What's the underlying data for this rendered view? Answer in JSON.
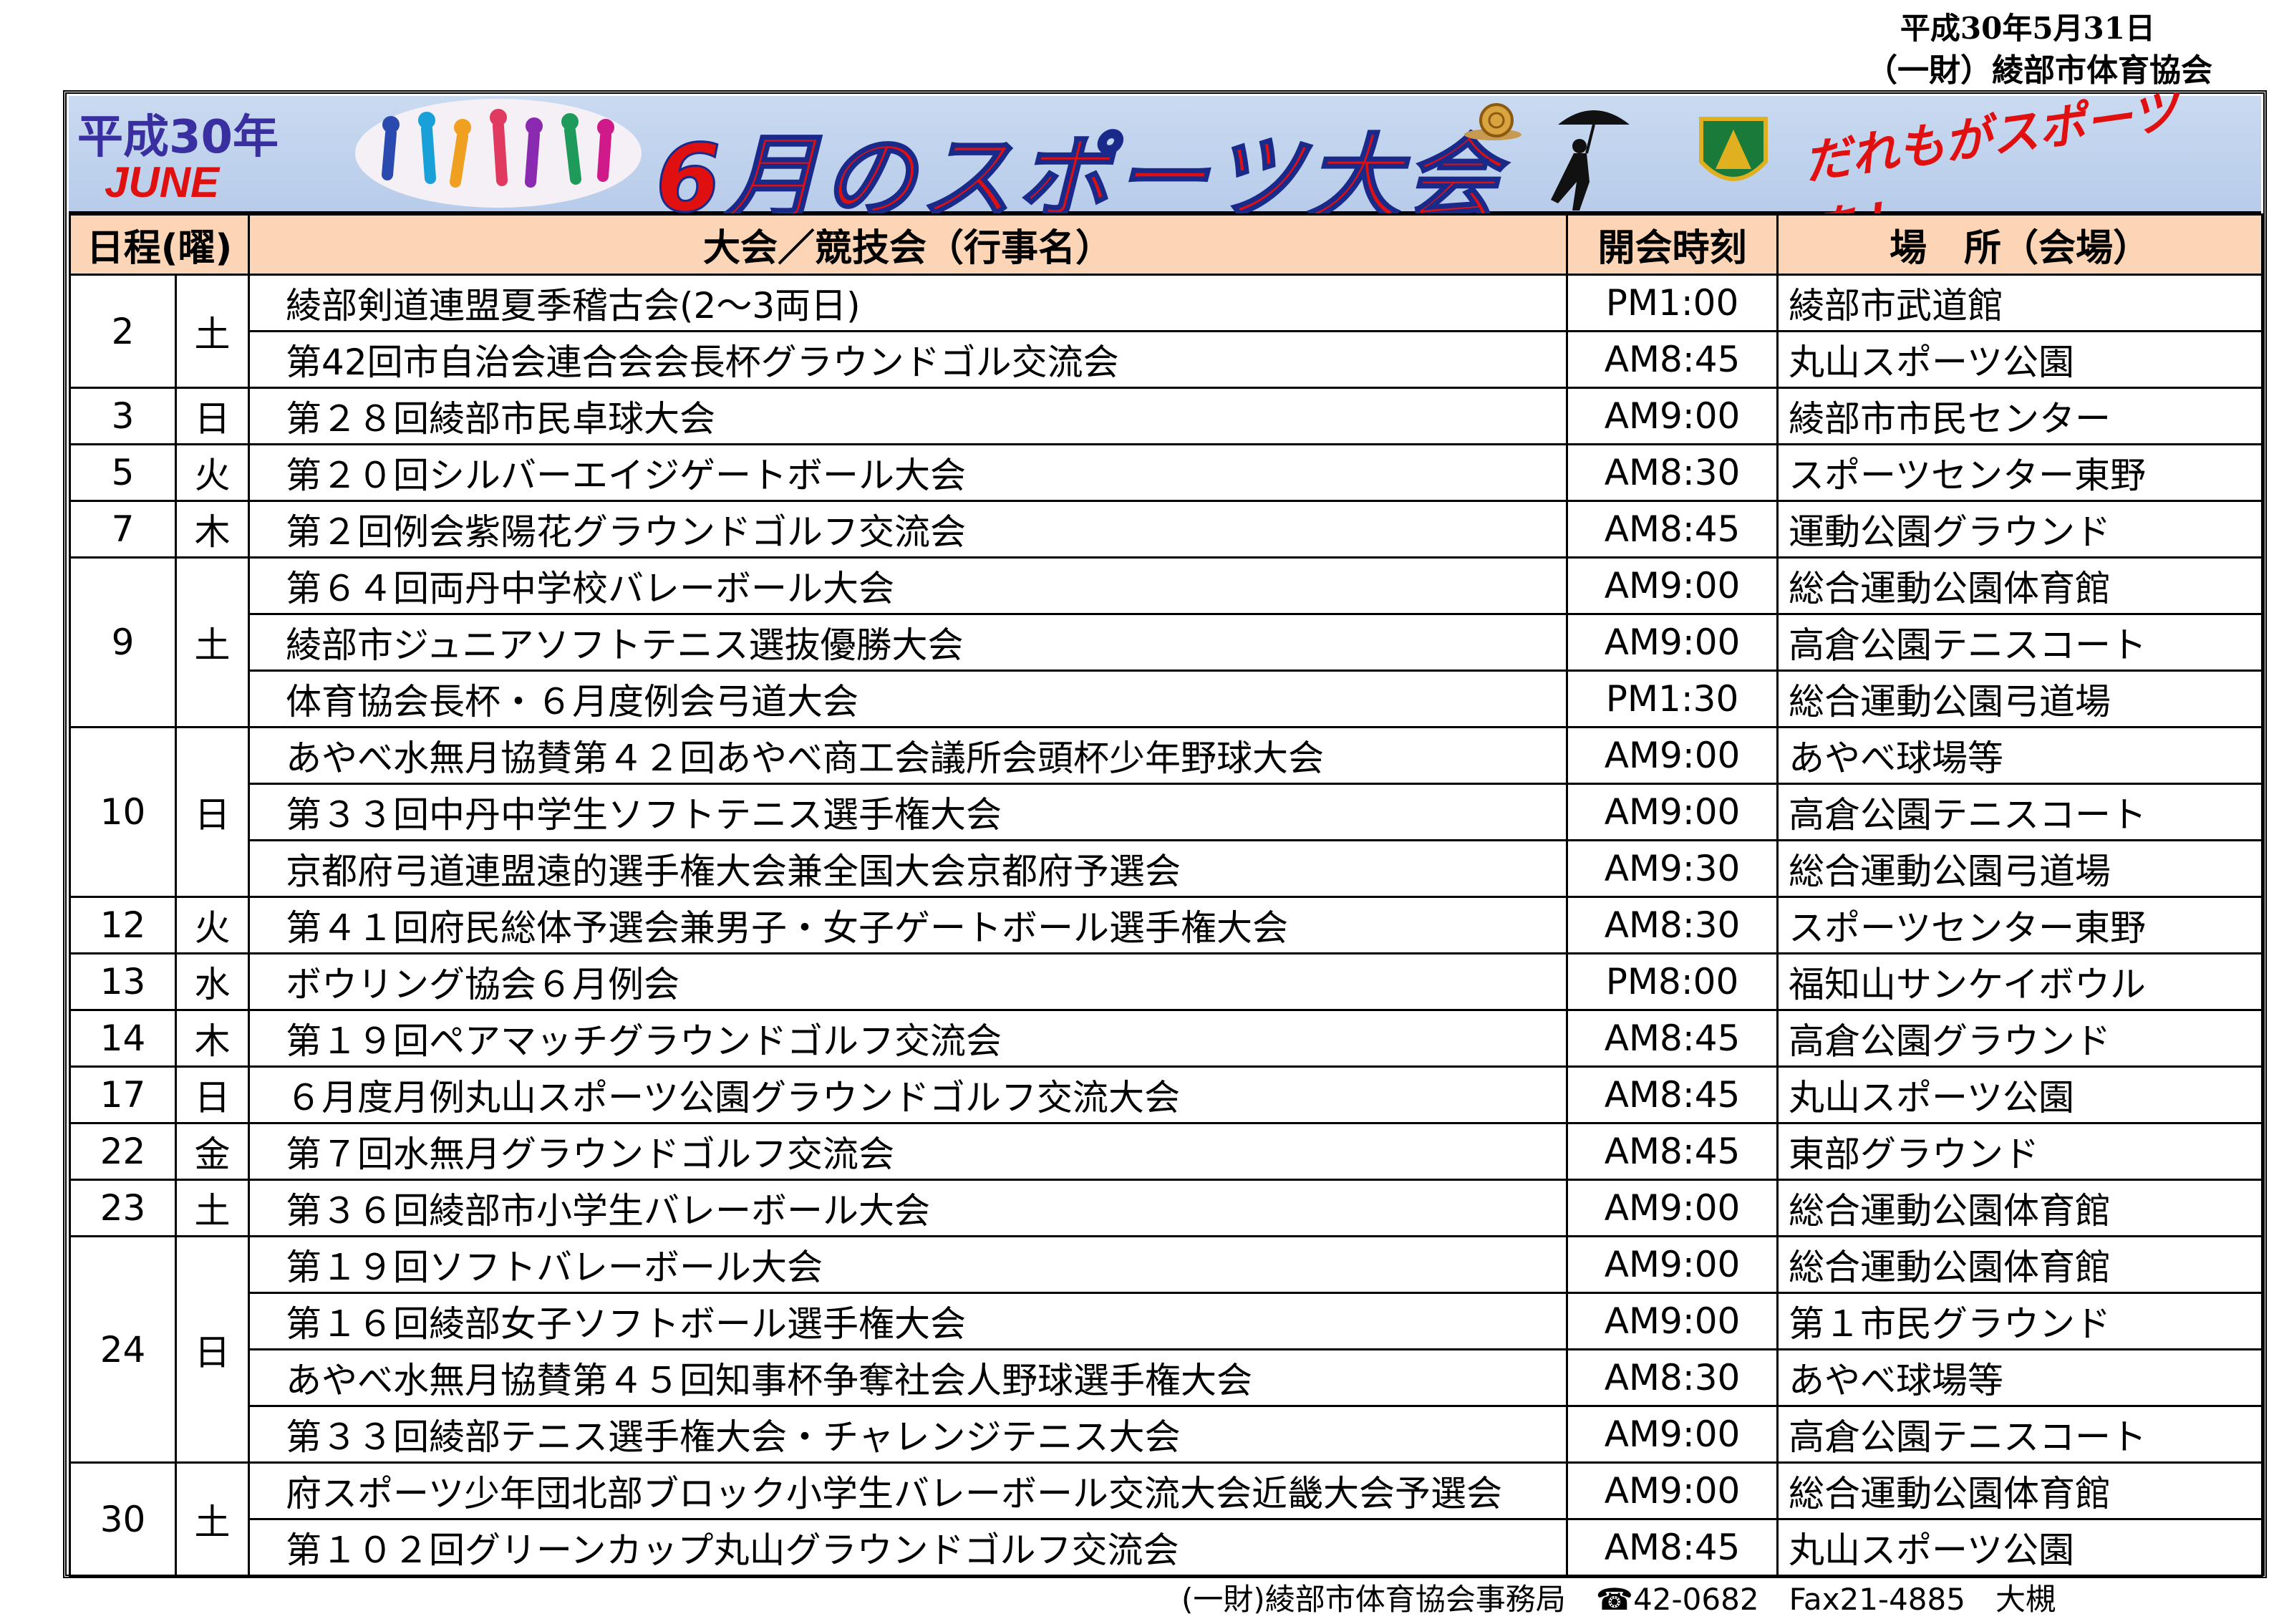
{
  "header": {
    "date": "平成30年5月31日",
    "org": "（一財）綾部市体育協会"
  },
  "banner": {
    "year": "平成30年",
    "month": "JUNE",
    "title": "6月のスポーツ大会",
    "slogan": "だれもがスポーツを！"
  },
  "columns": {
    "date": "日程(曜)",
    "event": "大会／競技会（行事名）",
    "time": "開会時刻",
    "place": "場　所（会場）"
  },
  "groups": [
    {
      "day": "2",
      "wd": "土",
      "rows": [
        {
          "event": "綾部剣道連盟夏季稽古会(2～3両日)",
          "time": "PM1:00",
          "place": "綾部市武道館"
        },
        {
          "event": "第42回市自治会連合会会長杯グラウンドゴル交流会",
          "time": "AM8:45",
          "place": "丸山スポーツ公園"
        }
      ]
    },
    {
      "day": "3",
      "wd": "日",
      "rows": [
        {
          "event": "第２８回綾部市民卓球大会",
          "time": "AM9:00",
          "place": "綾部市市民センター"
        }
      ]
    },
    {
      "day": "5",
      "wd": "火",
      "rows": [
        {
          "event": "第２０回シルバーエイジゲートボール大会",
          "time": "AM8:30",
          "place": "スポーツセンター東野"
        }
      ]
    },
    {
      "day": "7",
      "wd": "木",
      "rows": [
        {
          "event": "第２回例会紫陽花グラウンドゴルフ交流会",
          "time": "AM8:45",
          "place": "運動公園グラウンド"
        }
      ]
    },
    {
      "day": "9",
      "wd": "土",
      "rows": [
        {
          "event": "第６４回両丹中学校バレーボール大会",
          "time": "AM9:00",
          "place": "総合運動公園体育館"
        },
        {
          "event": "綾部市ジュニアソフトテニス選抜優勝大会",
          "time": "AM9:00",
          "place": "高倉公園テニスコート"
        },
        {
          "event": "体育協会長杯・６月度例会弓道大会",
          "time": "PM1:30",
          "place": "総合運動公園弓道場"
        }
      ]
    },
    {
      "day": "10",
      "wd": "日",
      "rows": [
        {
          "event": "あやべ水無月協賛第４２回あやべ商工会議所会頭杯少年野球大会",
          "time": "AM9:00",
          "place": "あやべ球場等"
        },
        {
          "event": "第３３回中丹中学生ソフトテニス選手権大会",
          "time": "AM9:00",
          "place": "高倉公園テニスコート"
        },
        {
          "event": "京都府弓道連盟遠的選手権大会兼全国大会京都府予選会",
          "time": "AM9:30",
          "place": "総合運動公園弓道場"
        }
      ]
    },
    {
      "day": "12",
      "wd": "火",
      "rows": [
        {
          "event": "第４１回府民総体予選会兼男子・女子ゲートボール選手権大会",
          "time": "AM8:30",
          "place": "スポーツセンター東野"
        }
      ]
    },
    {
      "day": "13",
      "wd": "水",
      "rows": [
        {
          "event": "ボウリング協会６月例会",
          "time": "PM8:00",
          "place": "福知山サンケイボウル"
        }
      ]
    },
    {
      "day": "14",
      "wd": "木",
      "rows": [
        {
          "event": "第１９回ペアマッチグラウンドゴルフ交流会",
          "time": "AM8:45",
          "place": "高倉公園グラウンド"
        }
      ]
    },
    {
      "day": "17",
      "wd": "日",
      "rows": [
        {
          "event": "６月度月例丸山スポーツ公園グラウンドゴルフ交流大会",
          "time": "AM8:45",
          "place": "丸山スポーツ公園"
        }
      ]
    },
    {
      "day": "22",
      "wd": "金",
      "rows": [
        {
          "event": "第７回水無月グラウンドゴルフ交流会",
          "time": "AM8:45",
          "place": "東部グラウンド"
        }
      ]
    },
    {
      "day": "23",
      "wd": "土",
      "rows": [
        {
          "event": "第３６回綾部市小学生バレーボール大会",
          "time": "AM9:00",
          "place": "総合運動公園体育館"
        }
      ]
    },
    {
      "day": "24",
      "wd": "日",
      "rows": [
        {
          "event": "第１９回ソフトバレーボール大会",
          "time": "AM9:00",
          "place": "総合運動公園体育館"
        },
        {
          "event": "第１６回綾部女子ソフトボール選手権大会",
          "time": "AM9:00",
          "place": "第１市民グラウンド"
        },
        {
          "event": "あやべ水無月協賛第４５回知事杯争奪社会人野球選手権大会",
          "time": "AM8:30",
          "place": "あやべ球場等"
        },
        {
          "event": "第３３回綾部テニス選手権大会・チャレンジテニス大会",
          "time": "AM9:00",
          "place": "高倉公園テニスコート"
        }
      ]
    },
    {
      "day": "30",
      "wd": "土",
      "rows": [
        {
          "event": "府スポーツ少年団北部ブロック小学生バレーボール交流大会近畿大会予選会",
          "time": "AM9:00",
          "place": "総合運動公園体育館"
        },
        {
          "event": "第１０２回グリーンカップ丸山グラウンドゴルフ交流会",
          "time": "AM8:45",
          "place": "丸山スポーツ公園"
        }
      ]
    }
  ],
  "footer": "(一財)綾部市体育協会事務局　☎42-0682　Fax21-4885　大槻"
}
